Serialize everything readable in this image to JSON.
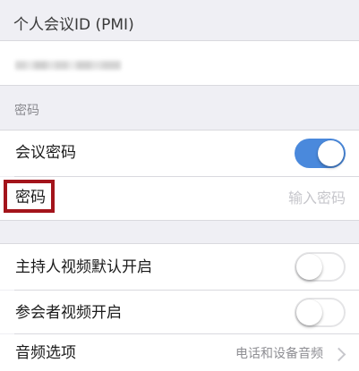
{
  "pmi_section": {
    "header": "个人会议ID (PMI)",
    "value": ""
  },
  "password_section": {
    "header": "密码",
    "meeting_password": {
      "label": "会议密码",
      "enabled": true
    },
    "password_field": {
      "label": "密码",
      "placeholder": "输入密码",
      "value": ""
    }
  },
  "video_section": {
    "host_video": {
      "label": "主持人视频默认开启",
      "enabled": false
    },
    "participant_video": {
      "label": "参会者视频开启",
      "enabled": false
    },
    "audio_options": {
      "label": "音频选项",
      "value": "电话和设备音频"
    }
  },
  "colors": {
    "toggle_on": "#4a89dc",
    "highlight": "#a3141b",
    "background": "#efeff4"
  },
  "icons": {
    "audio_options_chevron": "chevron-right-icon"
  }
}
